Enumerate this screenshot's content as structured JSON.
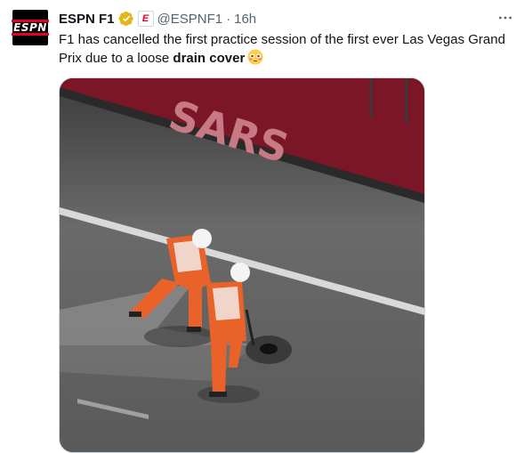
{
  "tweet": {
    "author_name": "ESPN F1",
    "handle": "@ESPNF1",
    "separator": "·",
    "time": "16h",
    "avatar_logo": "ESPN",
    "affiliate_badge": "E",
    "text_prefix": "F1 has cancelled the first practice session of the first ever Las Vegas Grand Prix due to a loose ",
    "text_bold": "drain cover",
    "emoji": "flushed-face",
    "media_sign_text": "SARS",
    "more_icon": "more-horizontal-icon",
    "verified_icon": "gold-verified-badge-icon"
  },
  "colors": {
    "verified_gold": "#e2b719",
    "espn_red": "#e4002b",
    "wall_red": "#7a1626",
    "marshal_orange": "#e8622a"
  }
}
